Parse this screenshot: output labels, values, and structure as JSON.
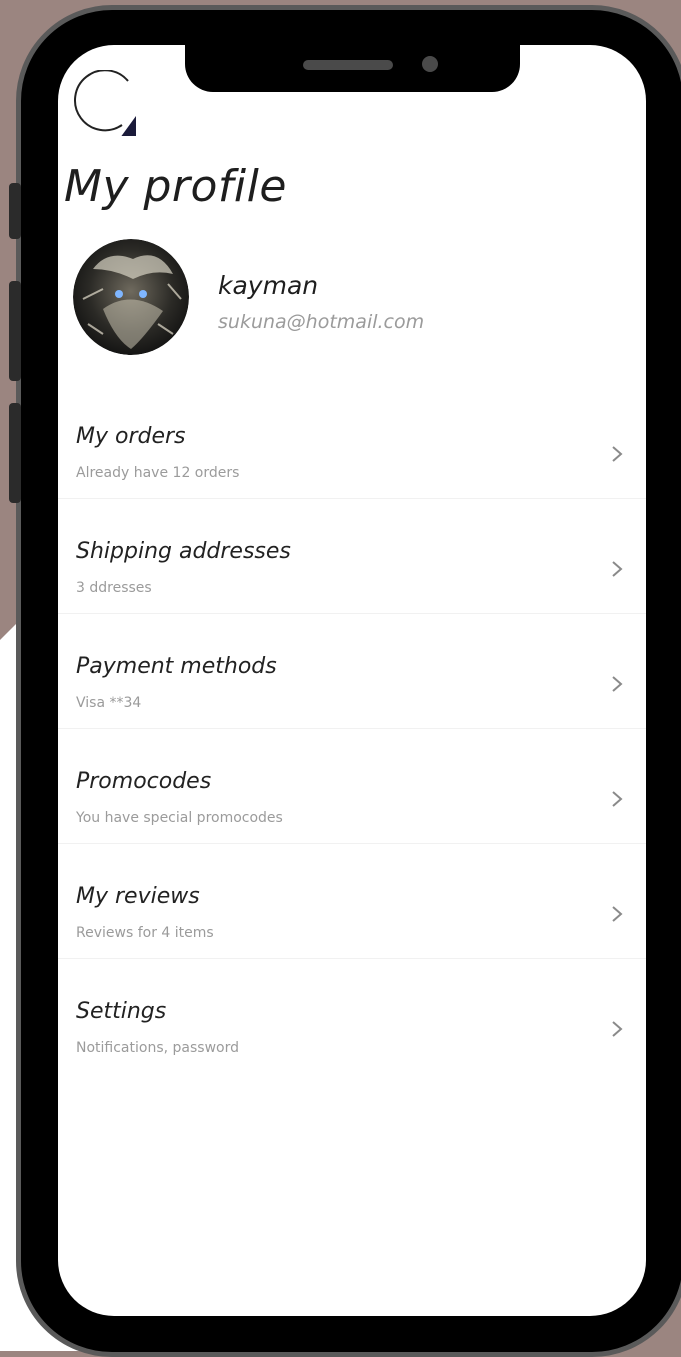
{
  "colors": {
    "background": "#9b8580",
    "frame": "#000000",
    "screen": "#ffffff",
    "text": "#1e1e1e",
    "muted": "#9b9b9b"
  },
  "header": {
    "refresh_icon": "refresh-icon",
    "title": "My profile"
  },
  "profile": {
    "name": "kayman",
    "email": "sukuna@hotmail.com"
  },
  "menu": [
    {
      "title": "My orders",
      "subtitle": "Already have 12 orders"
    },
    {
      "title": "Shipping addresses",
      "subtitle": "3 ddresses"
    },
    {
      "title": "Payment methods",
      "subtitle": "Visa  **34"
    },
    {
      "title": "Promocodes",
      "subtitle": "You have special promocodes"
    },
    {
      "title": "My reviews",
      "subtitle": "Reviews for 4 items"
    },
    {
      "title": "Settings",
      "subtitle": "Notifications, password"
    }
  ]
}
